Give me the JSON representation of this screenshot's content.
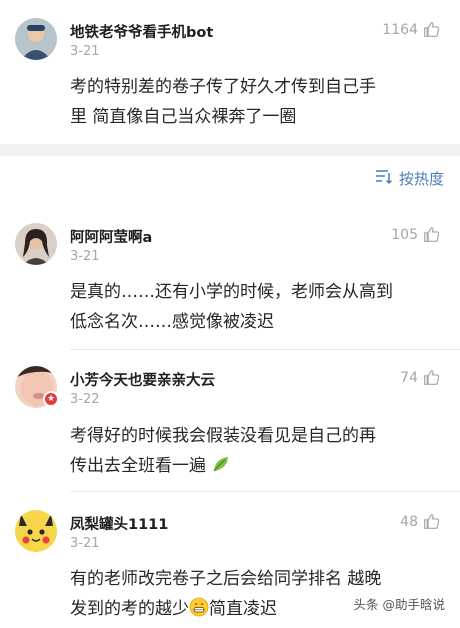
{
  "comments": [
    {
      "username": "地铁老爷爷看手机bot",
      "time": "3-21",
      "likes": "1164",
      "text_line1": "考的特别差的卷子传了好久才传到自己手",
      "text_line2": "里 简直像自己当众裸奔了一圈"
    },
    {
      "username": "阿阿阿莹啊a",
      "time": "3-21",
      "likes": "105",
      "text_line1": "是真的……还有小学的时候，老师会从高到",
      "text_line2": "低念名次……感觉像被凌迟"
    },
    {
      "username": "小芳今天也要亲亲大云",
      "time": "3-22",
      "likes": "74",
      "text_line1": "考得好的时候我会假装没看见是自己的再",
      "text_line2": "传出去全班看一遍"
    },
    {
      "username": "凤梨罐头1111",
      "time": "3-21",
      "likes": "48",
      "text_line1": "有的老师改完卷子之后会给同学排名 越晚",
      "text_line2_a": "发到的考的越少",
      "text_line2_b": "简直凌迟"
    }
  ],
  "sort": {
    "label": "按热度"
  },
  "watermark": "头条 @助手晗说",
  "colors": {
    "link_blue": "#4a7fb5",
    "meta_gray": "#a6a6a6",
    "badge_red": "#e23b3b"
  },
  "icons": {
    "like": "thumbs-up-icon",
    "sort": "sort-icon",
    "leaf_emoji": "leaf-emoji-icon",
    "grin_emoji": "grinning-emoji-icon"
  }
}
